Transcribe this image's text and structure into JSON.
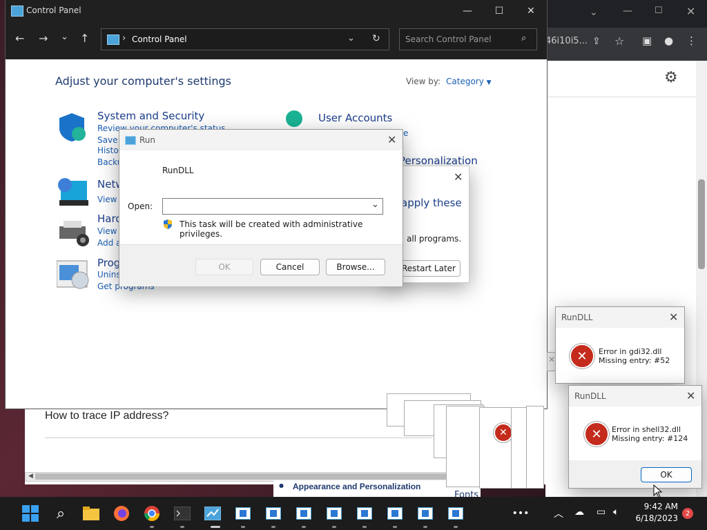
{
  "control_panel": {
    "title": "Control Panel",
    "address": "Control Panel",
    "search_placeholder": "Search Control Panel",
    "heading": "Adjust your computer's settings",
    "view_by_label": "View by:",
    "view_by_value": "Category",
    "categories": [
      {
        "title": "System and Security",
        "links": [
          "Review your computer's status",
          "Save b",
          "Histor",
          "Backu"
        ]
      },
      {
        "title": "Netw",
        "links": [
          "View n"
        ]
      },
      {
        "title": "Hard",
        "links": [
          "View d",
          "Add a"
        ]
      },
      {
        "title": "Prog",
        "links": [
          "Unins",
          "Get programs"
        ]
      },
      {
        "title": "User Accounts",
        "links": [
          "e"
        ]
      },
      {
        "title": "Personalization",
        "links": []
      }
    ]
  },
  "browser": {
    "url_fragment": "46i10i5..."
  },
  "background_page": {
    "question": "How to trace IP address?",
    "appearance": "Appearance and Personalization",
    "fonts": "Fonts"
  },
  "restart_dialog": {
    "text_line1": "apply these",
    "text_line2": "all programs.",
    "restart_later": "Restart Later"
  },
  "run_dialog": {
    "title": "Run",
    "description": "RunDLL",
    "open_label": "Open:",
    "open_value": "",
    "admin_note": "This task will be created with administrative privileges.",
    "ok": "OK",
    "cancel": "Cancel",
    "browse": "Browse..."
  },
  "error_dialogs": [
    {
      "title": "RunDLL",
      "line1": "Error in gdi32.dll",
      "line2": "Missing entry: #52"
    },
    {
      "title": "RunDLL",
      "line1": "Error in shell32.dll",
      "line2": "Missing entry: #124",
      "ok": "OK"
    }
  ],
  "taskbar": {
    "time": "9:42 AM",
    "date": "6/18/2023",
    "notification_count": "2",
    "overflow": "•••"
  }
}
